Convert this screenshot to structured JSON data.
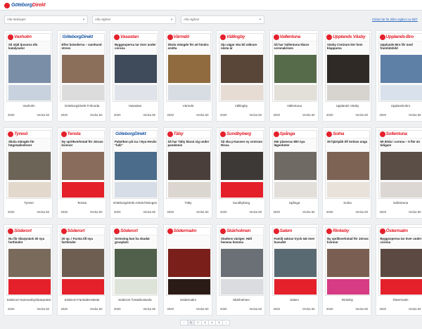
{
  "header": {
    "logo_text_a": "Göteborg",
    "logo_text_b": "Direkt"
  },
  "filters": {
    "desk": "Alla desktyper",
    "year": "Alla utgåvor",
    "edition": "Alla utgåvor",
    "link_all": "Klicka här för äldre utgåvor av MitT"
  },
  "editions": [
    {
      "masthead": "Vaxholm",
      "headline": "Så stjäl tjuvarna din katalysator",
      "name": "Vaxholm",
      "year": "2020",
      "week": "Vecka 50",
      "photo": "#7a8ea8",
      "ad": "#c8d2de"
    },
    {
      "masthead": "GöteborgDirekt",
      "gd": true,
      "headline": "Efter bränderna – samhund stress",
      "name": "GöteborgDirekt Frölunda",
      "year": "2020",
      "week": "Vecka 50",
      "photo": "#8b6f5a",
      "ad": "#dcdcdc"
    },
    {
      "masthead": "Vasastan",
      "headline": "Byggsoperna tar över under corona",
      "name": "Vasastan",
      "year": "2020",
      "week": "Vecka 50",
      "photo": "#3f4a5a",
      "ad": "#e0e4ea"
    },
    {
      "masthead": "Värmdö",
      "headline": "Skola stängde för att hindra smitta",
      "name": "Värmdö",
      "year": "2020",
      "week": "Vecka 50",
      "photo": "#8f6b3f",
      "ad": "#d8dde3"
    },
    {
      "masthead": "Vällingby",
      "headline": "Sju vägar ska bli säkrare nästa år",
      "name": "Vällingby",
      "year": "2020",
      "week": "Vecka 50",
      "photo": "#5a4638",
      "ad": "#e6dcd3"
    },
    {
      "masthead": "Vallentuna",
      "headline": "Så har Vallentuna klarat coronakrisen",
      "name": "Vallentuna",
      "year": "2020",
      "week": "Vecka 50",
      "photo": "#566b4a",
      "ad": "#e3e0da"
    },
    {
      "masthead": "Upplands Väsby",
      "headline": "Väsby Centrum kör hem klapparna",
      "name": "Upplands Väsby",
      "year": "2020",
      "week": "Vecka 50",
      "photo": "#2f2a26",
      "ad": "#d7d3cf"
    },
    {
      "masthead": "Upplands-Bro",
      "headline": "Upplands-Bro får mod framtidsbild",
      "name": "Upplands-Bro",
      "year": "2020",
      "week": "Vecka 50",
      "photo": "#5e7fa6",
      "ad": "#d9e2ec"
    },
    {
      "masthead": "Tyresö",
      "headline": "Skola stängde för högstadieelever",
      "name": "Tyresö",
      "year": "2020",
      "week": "Vecka 50",
      "photo": "#6d6458",
      "ad": "#e2d8cc"
    },
    {
      "masthead": "Tensta",
      "headline": "Ny sprökverkstad för Järvas kvinnor",
      "name": "Tensta",
      "year": "2020",
      "week": "Vecka 50",
      "photo": "#8a6c5c",
      "ad": "#e4202b"
    },
    {
      "masthead": "GöteborgDirekt",
      "gd": true,
      "headline": "Paketbon på ica i Nya Hovås \"lulli\"",
      "name": "GöteborgDirekt Askim/Hisingen",
      "year": "2020",
      "week": "Vecka 50",
      "photo": "#4b6c8a",
      "ad": "#d6dde6"
    },
    {
      "masthead": "Täby",
      "headline": "Så har Täby klarat sig under pandemin",
      "name": "Täby",
      "year": "2020",
      "week": "Vecka 50",
      "photo": "#4a3f3a",
      "ad": "#dcd6d0"
    },
    {
      "masthead": "Sundbyberg",
      "headline": "Så ska p-kassen ny centrum Rissa",
      "name": "Sundbyberg",
      "year": "2020",
      "week": "Vecka 50",
      "photo": "#3d3936",
      "ad": "#e4202b"
    },
    {
      "masthead": "Spånga",
      "headline": "Här planeras 800 nya lägenheter",
      "name": "Spånga",
      "year": "2020",
      "week": "Vecka 50",
      "photo": "#6f6a63",
      "ad": "#e2dfda"
    },
    {
      "masthead": "Solna",
      "headline": "30 hjärtpåb till Solnas unga",
      "name": "Solna",
      "year": "2020",
      "week": "Vecka 50",
      "photo": "#7d6354",
      "ad": "#e8e2db"
    },
    {
      "masthead": "Sollentuna",
      "headline": "59 döda i corona – 5 fler än tidigare",
      "name": "Sollentuna",
      "year": "2020",
      "week": "Vecka 50",
      "photo": "#5a4e46",
      "ad": "#dcd7d2"
    },
    {
      "masthead": "Söderort",
      "headline": "Nu får Skarpnäck 30 nya farthinder",
      "name": "Söderort Hammarby/Skarpnäck",
      "year": "2020",
      "week": "Vecka 50",
      "photo": "#7a6a5c",
      "ad": "#e4202b"
    },
    {
      "masthead": "Söderort",
      "headline": "20 sp. i Farsta till nya farthinder",
      "name": "Söderort Farsta/Enskede",
      "year": "2020",
      "week": "Vecka 50",
      "photo": "#6e5e52",
      "ad": "#e4202b"
    },
    {
      "masthead": "Söderort",
      "headline": "Grönsing kan ha skadat grusplats",
      "name": "Söderort Årsta/Enskede",
      "year": "2020",
      "week": "Vecka 50",
      "photo": "#51604a",
      "ad": "#dde3d8"
    },
    {
      "masthead": "Södermalm",
      "headline": "",
      "name": "Södermalm",
      "year": "2020",
      "week": "Vecka 50",
      "photo": "#7a1f1a",
      "ad": "#2b1b17"
    },
    {
      "masthead": "Skärholmen",
      "headline": "Stadens växiger. Häll hemma hemma",
      "name": "Skärholmen",
      "year": "2020",
      "week": "Vecka 50",
      "photo": "#6b6f76",
      "ad": "#dadcdf"
    },
    {
      "masthead": "Salem",
      "headline": "Familj saknar tryck tak över huvudet",
      "name": "Salem",
      "year": "2020",
      "week": "Vecka 50",
      "photo": "#5a6a73",
      "ad": "#e4202b"
    },
    {
      "masthead": "Rinkeby",
      "headline": "Ny språkverkstad för Järvas kvinnor",
      "name": "Rinkeby",
      "year": "2020",
      "week": "Vecka 50",
      "photo": "#7b5e52",
      "ad": "#d63b84"
    },
    {
      "masthead": "Östermalm",
      "headline": "Byggsoperna tar över under corona",
      "name": "Östermalm",
      "year": "2020",
      "week": "Vecka 50",
      "photo": "#5c4a42",
      "ad": "#e4202b"
    }
  ],
  "pagination": [
    "‹",
    "1",
    "2",
    "3",
    "4",
    "5",
    "›"
  ]
}
